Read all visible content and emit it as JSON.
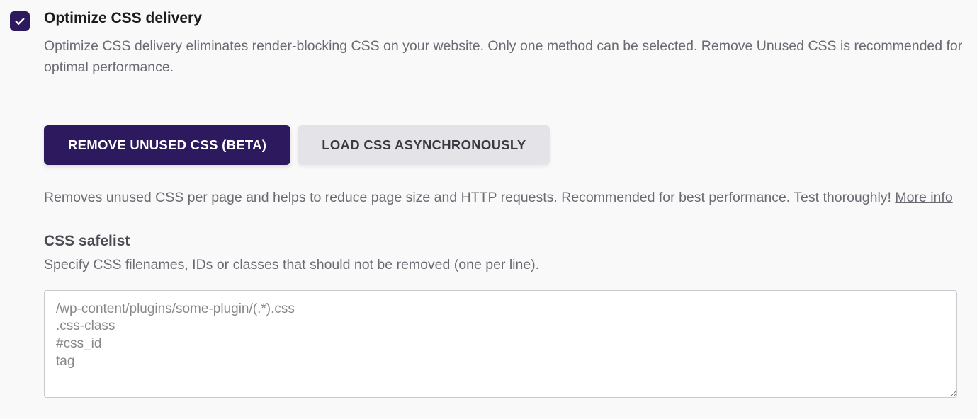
{
  "option": {
    "title": "Optimize CSS delivery",
    "description": "Optimize CSS delivery eliminates render-blocking CSS on your website. Only one method can be selected. Remove Unused CSS is recommended for optimal performance."
  },
  "buttons": {
    "remove_unused": "REMOVE UNUSED CSS (BETA)",
    "load_async": "LOAD CSS ASYNCHRONOUSLY"
  },
  "remove_unused_help": "Removes unused CSS per page and helps to reduce page size and HTTP requests. Recommended for best performance. Test thoroughly! ",
  "more_info_label": "More info",
  "safelist": {
    "title": "CSS safelist",
    "description": "Specify CSS filenames, IDs or classes that should not be removed (one per line).",
    "placeholder": "/wp-content/plugins/some-plugin/(.*).css\n.css-class\n#css_id\ntag"
  }
}
